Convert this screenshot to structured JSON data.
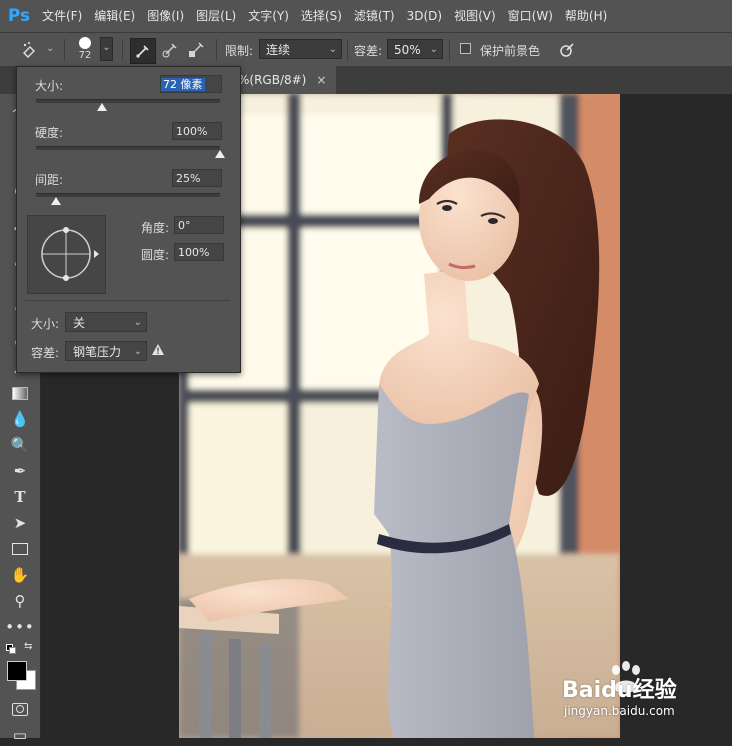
{
  "app": {
    "logo": "Ps"
  },
  "menu": [
    "文件(F)",
    "编辑(E)",
    "图像(I)",
    "图层(L)",
    "文字(Y)",
    "选择(S)",
    "滤镜(T)",
    "3D(D)",
    "视图(V)",
    "窗口(W)",
    "帮助(H)"
  ],
  "options": {
    "brush_size": "72",
    "limit_label": "限制:",
    "limit_value": "连续",
    "tolerance_label": "容差:",
    "tolerance_value": "50%",
    "protect_label": "保护前景色"
  },
  "document": {
    "tab_title": "%(RGB/8#)",
    "close_glyph": "×"
  },
  "brush_panel": {
    "size_label": "大小:",
    "size_value": "72 像素",
    "hardness_label": "硬度:",
    "hardness_value": "100%",
    "hardness_level": 1.0,
    "spacing_label": "间距:",
    "spacing_value": "25%",
    "size_level": 0.36,
    "spacing_level": 0.11,
    "angle_label": "角度:",
    "angle_value": "0°",
    "roundness_label": "圆度:",
    "roundness_value": "100%",
    "dyn_size_label": "大小:",
    "dyn_size_value": "关",
    "dyn_tol_label": "容差:",
    "dyn_tol_value": "钢笔压力"
  },
  "watermark": {
    "brand": "Baidu经验",
    "url": "jingyan.baidu.com"
  },
  "colors": {
    "panel": "#535353",
    "canvas": "#282828",
    "accent": "#31a8ff",
    "selection": "#2a63b4"
  }
}
